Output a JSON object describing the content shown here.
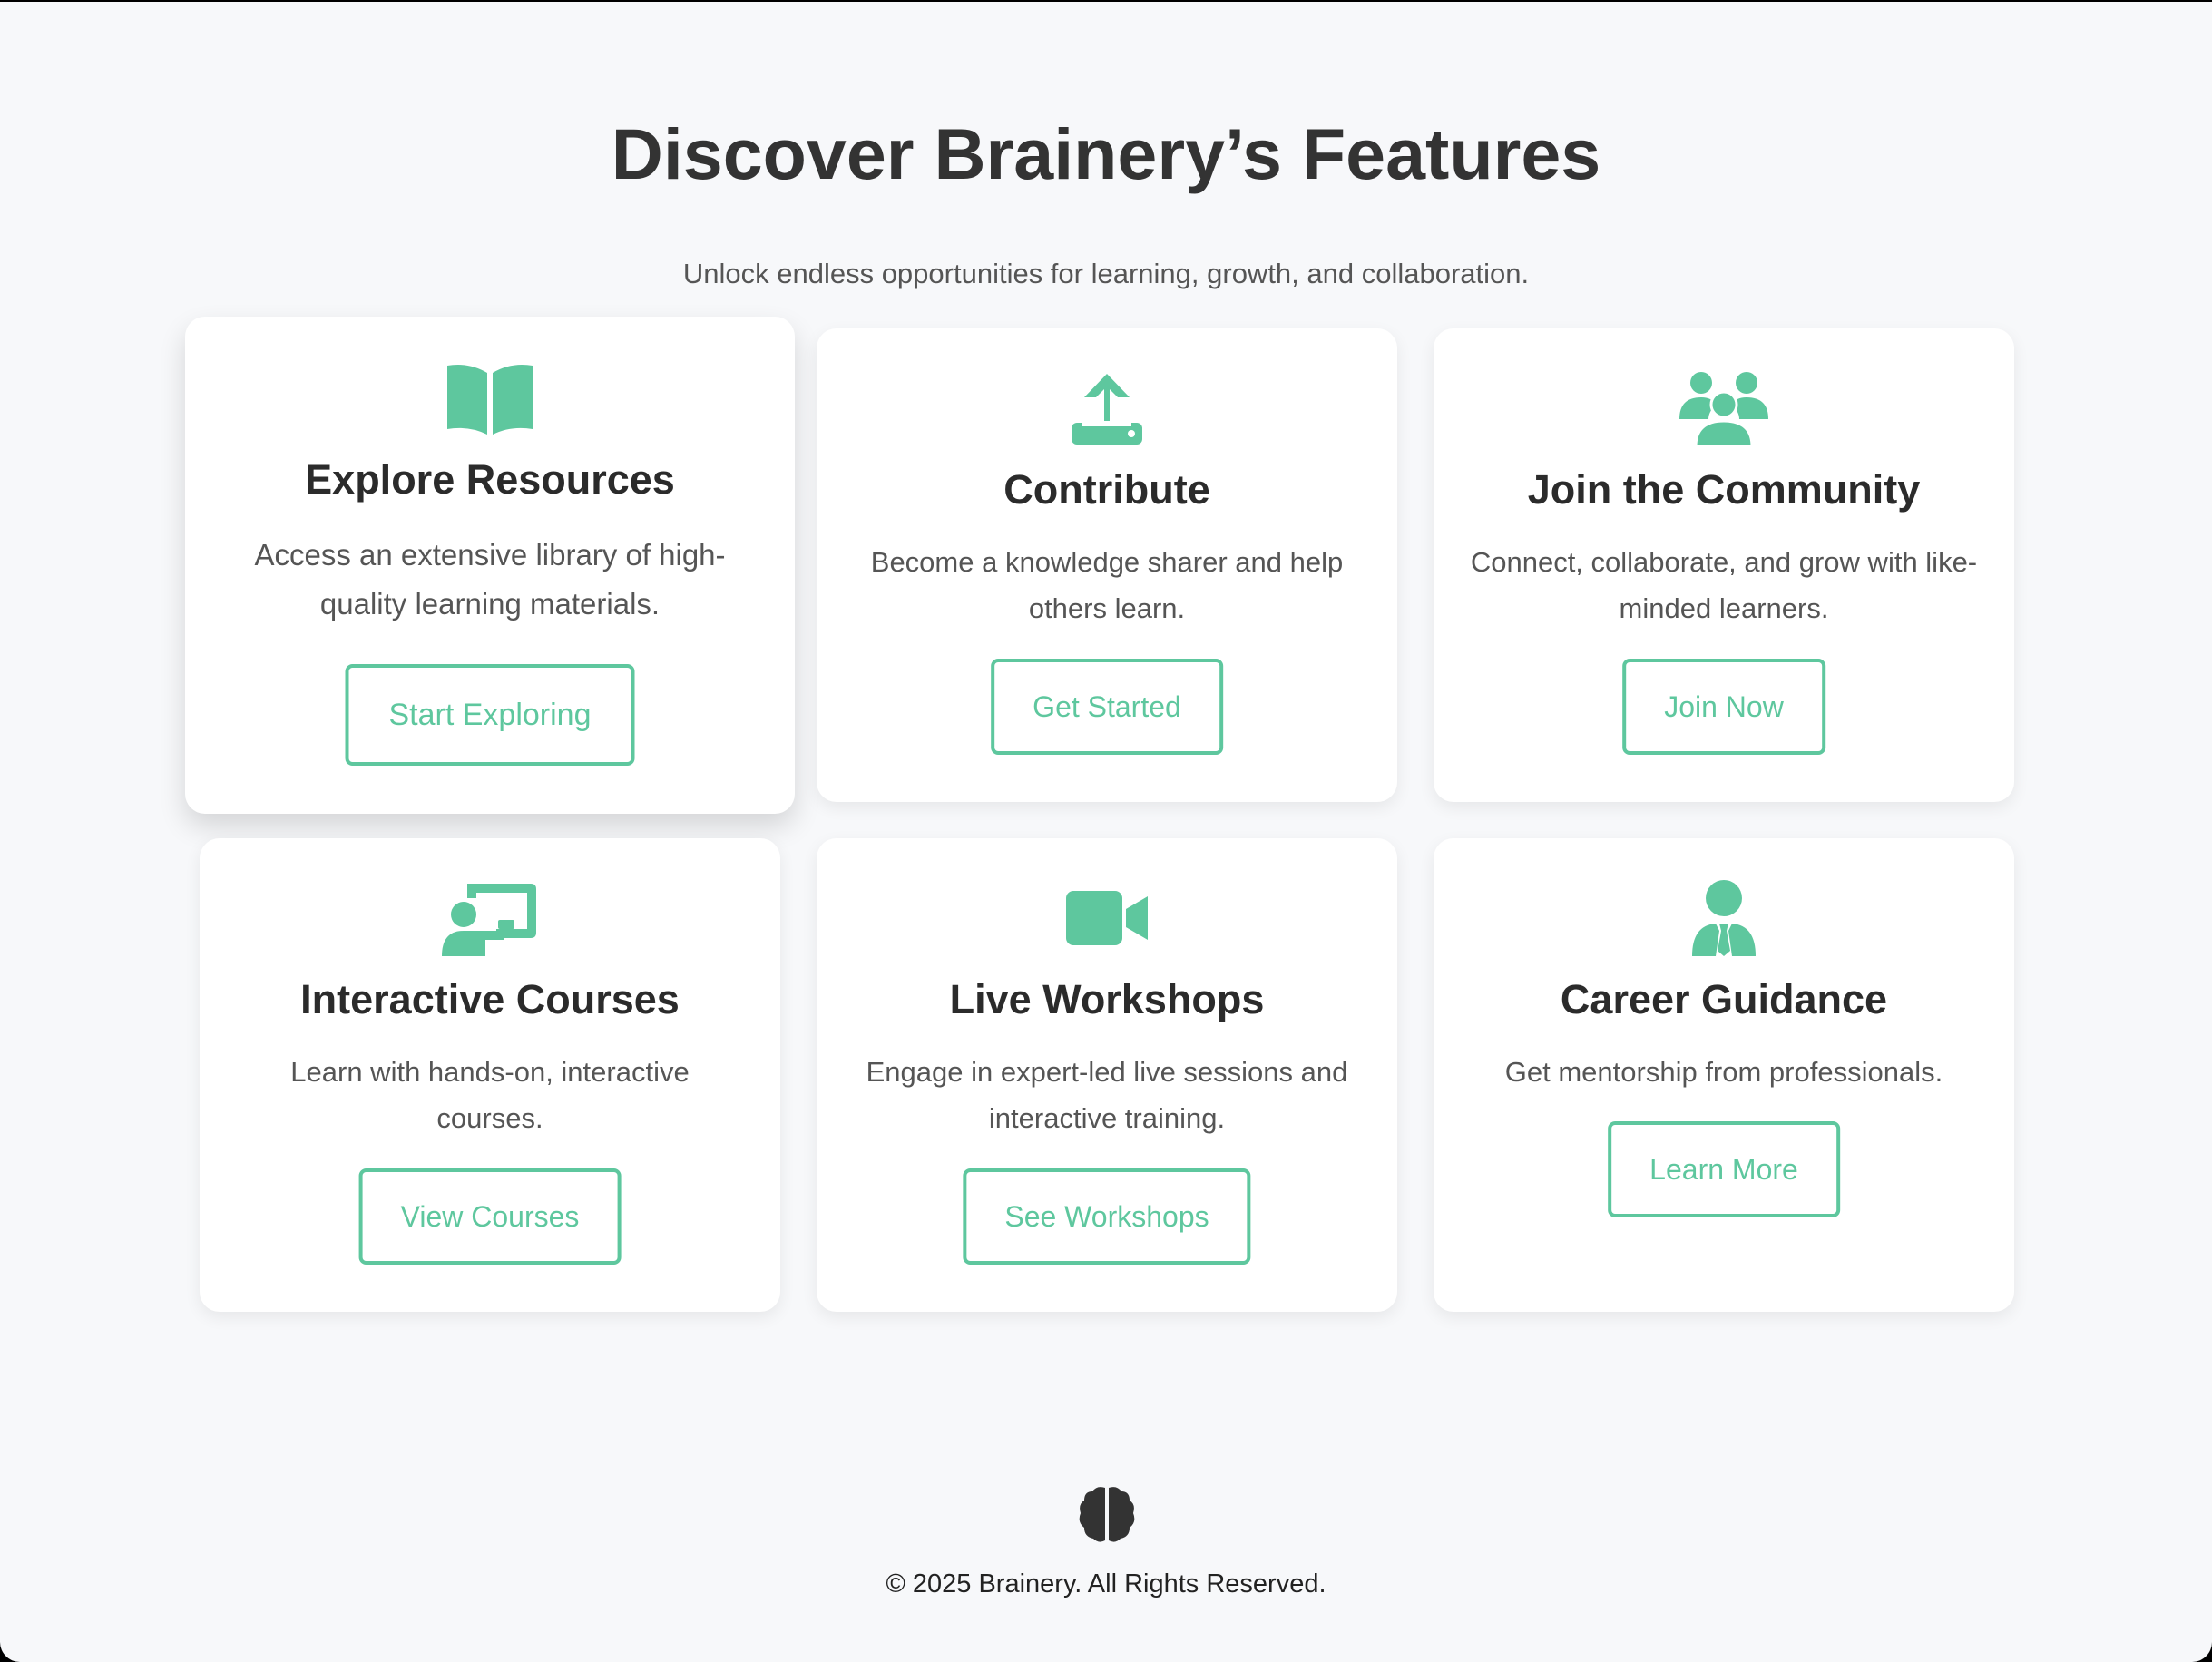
{
  "header": {
    "title": "Discover Brainery’s Features",
    "subtitle": "Unlock endless opportunities for learning, growth, and collaboration."
  },
  "colors": {
    "accent": "#5ec79e",
    "text_dark": "#333333",
    "text_muted": "#555555",
    "card_background": "#ffffff",
    "page_background": "#f7f8fa"
  },
  "features": [
    {
      "icon": "book-open-icon",
      "title": "Explore Resources",
      "description": "Access an extensive library of high-quality learning materials.",
      "button_label": "Start Exploring"
    },
    {
      "icon": "upload-icon",
      "title": "Contribute",
      "description": "Become a knowledge sharer and help others learn.",
      "button_label": "Get Started"
    },
    {
      "icon": "users-icon",
      "title": "Join the Community",
      "description": "Connect, collaborate, and grow with like-minded learners.",
      "button_label": "Join Now"
    },
    {
      "icon": "chalkboard-teacher-icon",
      "title": "Interactive Courses",
      "description": "Learn with hands-on, interactive courses.",
      "button_label": "View Courses"
    },
    {
      "icon": "video-camera-icon",
      "title": "Live Workshops",
      "description": "Engage in expert-led live sessions and interactive training.",
      "button_label": "See Workshops"
    },
    {
      "icon": "user-tie-icon",
      "title": "Career Guidance",
      "description": "Get mentorship from professionals.",
      "button_label": "Learn More"
    }
  ],
  "footer": {
    "logo_icon": "brain-icon",
    "copyright": "© 2025 Brainery. All Rights Reserved."
  }
}
